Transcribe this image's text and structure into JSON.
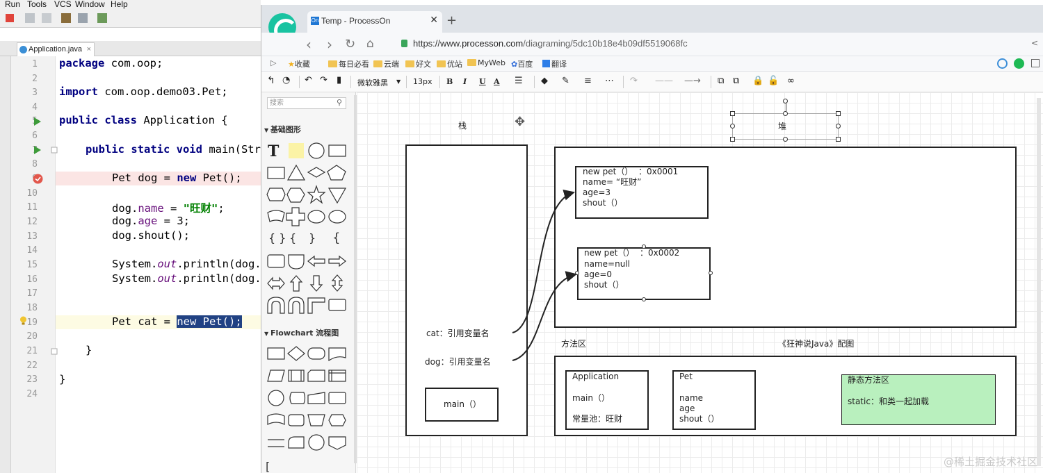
{
  "ide": {
    "menu": [
      "Run",
      "Tools",
      "VCS",
      "Window",
      "Help"
    ],
    "tab_label": "Application.java",
    "line_numbers": [
      "1",
      "2",
      "3",
      "4",
      "5",
      "6",
      "7",
      "8",
      "9",
      "10",
      "11",
      "12",
      "13",
      "14",
      "15",
      "16",
      "17",
      "18",
      "19",
      "20",
      "21",
      "22",
      "23",
      "24"
    ],
    "code": {
      "l1_kw": "package",
      "l1_rest": " com.oop;",
      "l3_kw": "import",
      "l3_rest": " com.oop.demo03.Pet;",
      "l5_kw": "public class",
      "l5_rest": " Application {",
      "l7_kw": "public static void",
      "l7_rest": " main(Str",
      "l9_a": "Pet dog = ",
      "l9_kw": "new",
      "l9_b": " Pet();",
      "l11_a": "dog.",
      "l11_fld": "name",
      "l11_b": " = ",
      "l11_str": "\"旺财\"",
      "l11_c": ";",
      "l12_a": "dog.",
      "l12_fld": "age",
      "l12_b": " = 3;",
      "l13": "dog.shout();",
      "l15_a": "System.",
      "l15_it": "out",
      "l15_b": ".println(dog.",
      "l16_a": "System.",
      "l16_it": "out",
      "l16_b": ".println(dog.",
      "l19_a": "Pet cat = ",
      "l19_sel": "new Pet();",
      "l21": "}",
      "l23": "}"
    }
  },
  "browser": {
    "tab_title": "Temp - ProcessOn",
    "tab_favicon": "On",
    "url_scheme": "https://www.",
    "url_domain": "processon.com",
    "url_path": "/diagraming/5dc10b18e4b09df5519068fc",
    "bookmarks": [
      "收藏",
      "每日必看",
      "云端",
      "好文",
      "优站",
      "MyWeb",
      "百度",
      "翻译"
    ],
    "toolbar": {
      "font": "微软雅黑",
      "size": "13px",
      "bold": "B",
      "italic": "I",
      "underline": "U",
      "fontcolor": "A"
    }
  },
  "panel": {
    "search_placeholder": "搜索",
    "section_basic": "基础图形",
    "section_flowchart": "Flowchart 流程图"
  },
  "diagram": {
    "stack_label": "栈",
    "heap_label": "堆",
    "method_area_label": "方法区",
    "caption": "《狂神说Java》配图",
    "obj1": {
      "line1": "new pet（）  ：0x0001",
      "line2": "name= “旺财”",
      "line3": "age=3",
      "line4": "shout（）"
    },
    "obj2": {
      "line1": "new pet（）  ：0x0002",
      "line2": "name=null",
      "line3": "age=0",
      "line4": "shout（）"
    },
    "cat_ref": "cat：引用变量名",
    "dog_ref": "dog：引用变量名",
    "main_frame": "main（）",
    "app_class": {
      "title": "Application",
      "main": "main（）",
      "pool": "常量池：旺财"
    },
    "pet_class": {
      "title": "Pet",
      "f1": "name",
      "f2": "age",
      "f3": "shout（）"
    },
    "static_area": {
      "title": "静态方法区",
      "body": "static：和类一起加载",
      "fill": "#b9f0be"
    }
  },
  "watermark": "@稀土掘金技术社区"
}
